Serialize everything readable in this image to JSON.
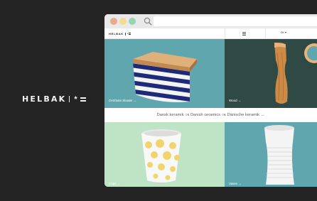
{
  "brand": {
    "name": "HELBAK",
    "mark": "*"
  },
  "browser": {
    "window_controls": [
      "close",
      "minimize",
      "maximize"
    ],
    "search_icon": "search-icon"
  },
  "site": {
    "nav": {
      "logo_name": "HELBAK",
      "logo_mark": "*",
      "menu_icon": "hamburger-icon",
      "language": "DK"
    },
    "tiles": [
      {
        "label": "Ovnfaste Skaale →"
      },
      {
        "label": "Wood →"
      },
      {
        "label": "Cups →"
      },
      {
        "label": "Vases →"
      }
    ],
    "band_text": "Dansk keramik ○κ Danish ceramics ○κ Dänische keramik →"
  },
  "colors": {
    "background": "#242424",
    "tile_teal": "#5fa6ae",
    "tile_dark_green": "#2f4a45",
    "tile_mint": "#bfe3c5",
    "stripe_navy": "#1e2a78",
    "wood": "#cc8a45",
    "dot_yellow": "#f1d56c"
  }
}
